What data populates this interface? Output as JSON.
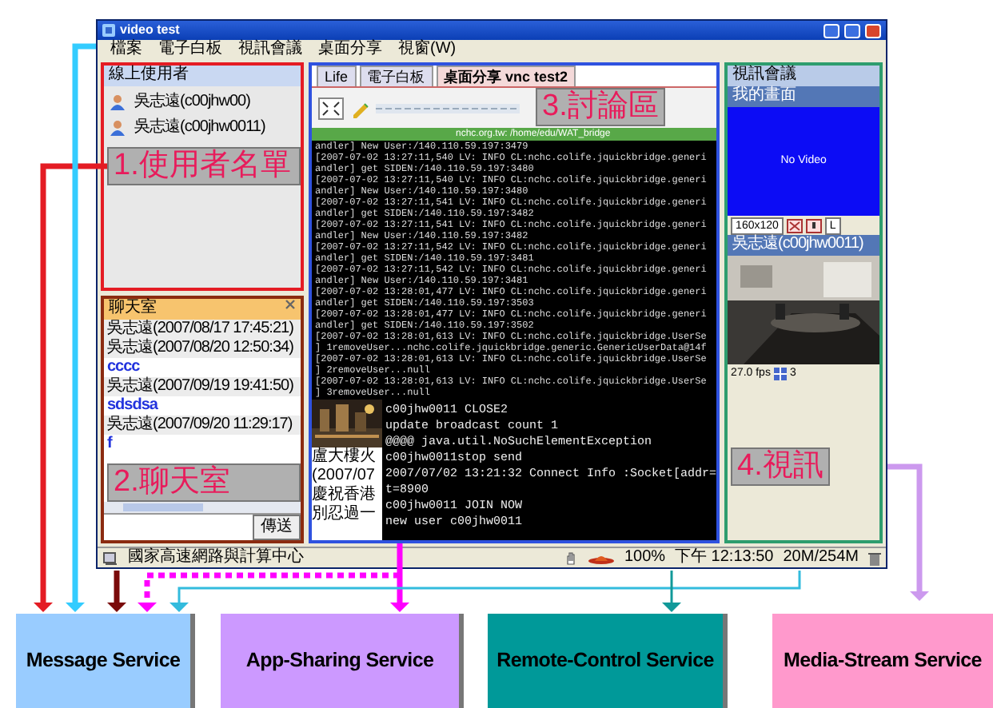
{
  "window": {
    "title": "video test",
    "menu": [
      "檔案",
      "電子白板",
      "視訊會議",
      "桌面分享",
      "視窗(W)"
    ]
  },
  "user_list": {
    "title": "線上使用者",
    "users": [
      {
        "name": "吳志遠(c00jhw00)"
      },
      {
        "name": "吳志遠(c00jhw0011)"
      }
    ]
  },
  "chat": {
    "title": "聊天室",
    "send_button": "傳送",
    "messages": [
      {
        "kind": "header",
        "text": "吳志遠(2007/08/17 17:45:21)"
      },
      {
        "kind": "header",
        "text": "吳志遠(2007/08/20 12:50:34)"
      },
      {
        "kind": "body",
        "text": "cccc"
      },
      {
        "kind": "header",
        "text": "吳志遠(2007/09/19 19:41:50)"
      },
      {
        "kind": "body",
        "text": "sdsdsa"
      },
      {
        "kind": "header",
        "text": "吳志遠(2007/09/20 11:29:17)"
      },
      {
        "kind": "body",
        "text": "f"
      }
    ]
  },
  "tabs": [
    {
      "label": "Life",
      "selected": false
    },
    {
      "label": "電子白板",
      "selected": false
    },
    {
      "label": "桌面分享 vnc test2",
      "selected": true
    }
  ],
  "path_bar": "nchc.org.tw: /home/edu/WAT_bridge",
  "console_log": [
    "andler] New User:/140.110.59.197:3479",
    "[2007-07-02 13:27:11,540 LV: INFO CL:nchc.colife.jquickbridge.generi",
    "andler] get SIDEN:/140.110.59.197:3480",
    "[2007-07-02 13:27:11,540 LV: INFO CL:nchc.colife.jquickbridge.generi",
    "andler] New User:/140.110.59.197:3480",
    "[2007-07-02 13:27:11,541 LV: INFO CL:nchc.colife.jquickbridge.generi",
    "andler] get SIDEN:/140.110.59.197:3482",
    "[2007-07-02 13:27:11,541 LV: INFO CL:nchc.colife.jquickbridge.generi",
    "andler] New User:/140.110.59.197:3482",
    "[2007-07-02 13:27:11,542 LV: INFO CL:nchc.colife.jquickbridge.generi",
    "andler] get SIDEN:/140.110.59.197:3481",
    "[2007-07-02 13:27:11,542 LV: INFO CL:nchc.colife.jquickbridge.generi",
    "andler] New User:/140.110.59.197:3481",
    "[2007-07-02 13:28:01,477 LV: INFO CL:nchc.colife.jquickbridge.generi",
    "andler] get SIDEN:/140.110.59.197:3503",
    "[2007-07-02 13:28:01,477 LV: INFO CL:nchc.colife.jquickbridge.generi",
    "andler] get SIDEN:/140.110.59.197:3502",
    "[2007-07-02 13:28:01,613 LV: INFO CL:nchc.colife.jquickbridge.UserSe",
    "] 1removeUser...nchc.colife.jquickbridge.generic.GenericUserData@14f",
    "[2007-07-02 13:28:01,613 LV: INFO CL:nchc.colife.jquickbridge.UserSe",
    "] 2removeUser...null",
    "[2007-07-02 13:28:01,613 LV: INFO CL:nchc.colife.jquickbridge.UserSe",
    "] 3removeUser...null"
  ],
  "news": [
    "盧大樓火",
    "(2007/07",
    "慶祝香港",
    "別忍過一"
  ],
  "console_output": [
    "c00jhw0011 CLOSE2",
    "update broadcast count 1",
    "@@@@ java.util.NoSuchElementException",
    "c00jhw0011stop send",
    "2007/07/02 13:21:32 Connect Info :Socket[addr=",
    "t=8900",
    "c00jhw0011 JOIN NOW",
    "new user c00jhw0011"
  ],
  "video": {
    "title": "視訊會議",
    "my_view": "我的畫面",
    "no_video": "No Video",
    "resolution": "160x120",
    "quality": "L",
    "remote_user": "吳志遠(c00jhw0011)",
    "fps": "27.0 fps",
    "count": "3"
  },
  "status_bar": {
    "org": "國家高速網路與計算中心",
    "zoom": "100%",
    "time": "下午 12:13:50",
    "memory": "20M/254M"
  },
  "annotations": [
    "1.使用者名單",
    "2.聊天室",
    "3.討論區",
    "4.視訊"
  ],
  "services": [
    {
      "name": "Message Service",
      "color": "#99ccff"
    },
    {
      "name": "App-Sharing Service",
      "color": "#cc99ff"
    },
    {
      "name": "Remote-Control Service",
      "color": "#009999"
    },
    {
      "name": "Media-Stream Service",
      "color": "#ff99cc"
    }
  ]
}
